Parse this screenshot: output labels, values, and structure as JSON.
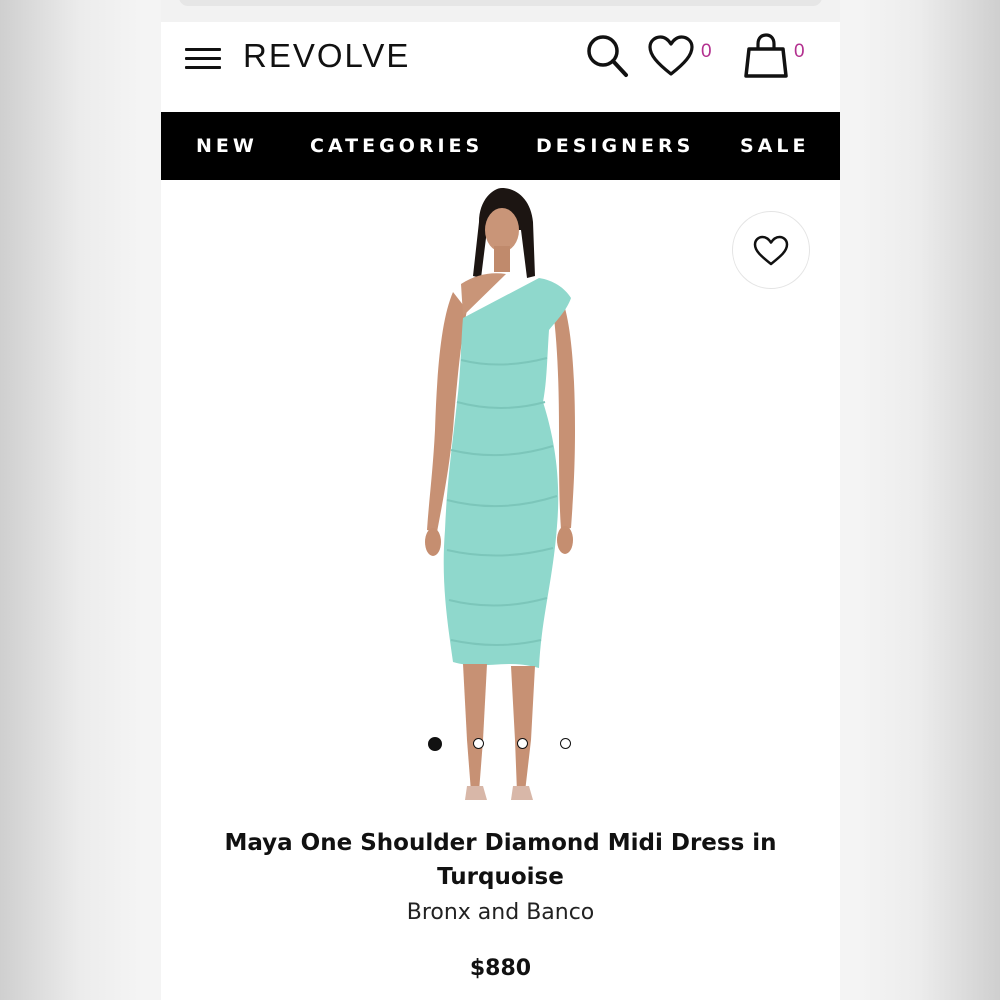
{
  "header": {
    "logo": "REVOLVE",
    "wishlist_count": "0",
    "bag_count": "0",
    "accent_color": "#b3308f"
  },
  "nav": {
    "items": [
      {
        "label": "NEW"
      },
      {
        "label": "CATEGORIES"
      },
      {
        "label": "DESIGNERS"
      },
      {
        "label": "SALE"
      }
    ]
  },
  "carousel": {
    "image_count": 4,
    "active_index": 0,
    "dress_color": "#8fd8cc"
  },
  "product": {
    "title": "Maya One Shoulder Diamond Midi Dress in Turquoise",
    "brand": "Bronx and Banco",
    "price": "$880"
  },
  "icons": [
    "menu-icon",
    "search-icon",
    "heart-icon",
    "bag-icon",
    "heart-outline-icon"
  ]
}
